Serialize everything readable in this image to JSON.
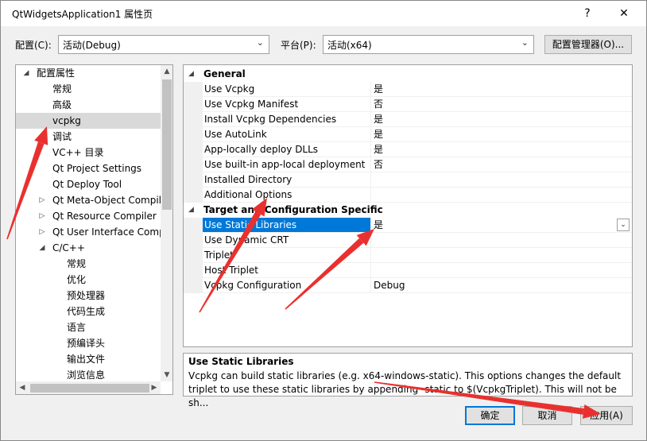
{
  "window": {
    "title": "QtWidgetsApplication1 属性页",
    "help_glyph": "?",
    "close_glyph": "✕"
  },
  "config": {
    "label": "配置(C):",
    "value": "活动(Debug)",
    "platform_label": "平台(P):",
    "platform_value": "活动(x64)",
    "manager_button": "配置管理器(O)..."
  },
  "tree": {
    "items": [
      {
        "label": "配置属性",
        "expander": "◢",
        "level": 0
      },
      {
        "label": "常规",
        "expander": "",
        "level": 1
      },
      {
        "label": "高级",
        "expander": "",
        "level": 1
      },
      {
        "label": "vcpkg",
        "expander": "",
        "level": 1,
        "selected": true
      },
      {
        "label": "调试",
        "expander": "",
        "level": 1
      },
      {
        "label": "VC++ 目录",
        "expander": "",
        "level": 1
      },
      {
        "label": "Qt Project Settings",
        "expander": "",
        "level": 1
      },
      {
        "label": "Qt Deploy Tool",
        "expander": "",
        "level": 1
      },
      {
        "label": "Qt Meta-Object Compil",
        "expander": "▷",
        "level": 1
      },
      {
        "label": "Qt Resource Compiler",
        "expander": "▷",
        "level": 1
      },
      {
        "label": "Qt User Interface Comp",
        "expander": "▷",
        "level": 1
      },
      {
        "label": "C/C++",
        "expander": "◢",
        "level": 1
      },
      {
        "label": "常规",
        "expander": "",
        "level": 2
      },
      {
        "label": "优化",
        "expander": "",
        "level": 2
      },
      {
        "label": "预处理器",
        "expander": "",
        "level": 2
      },
      {
        "label": "代码生成",
        "expander": "",
        "level": 2
      },
      {
        "label": "语言",
        "expander": "",
        "level": 2
      },
      {
        "label": "预编译头",
        "expander": "",
        "level": 2
      },
      {
        "label": "输出文件",
        "expander": "",
        "level": 2
      },
      {
        "label": "浏览信息",
        "expander": "",
        "level": 2
      }
    ]
  },
  "grid": {
    "groups": [
      {
        "label": "General",
        "rows": [
          {
            "name": "Use Vcpkg",
            "value": "是"
          },
          {
            "name": "Use Vcpkg Manifest",
            "value": "否"
          },
          {
            "name": "Install Vcpkg Dependencies",
            "value": "是"
          },
          {
            "name": "Use AutoLink",
            "value": "是"
          },
          {
            "name": "App-locally deploy DLLs",
            "value": "是"
          },
          {
            "name": "Use built-in app-local deployment",
            "value": "否"
          },
          {
            "name": "Installed Directory",
            "value": ""
          },
          {
            "name": "Additional Options",
            "value": ""
          }
        ]
      },
      {
        "label": "Target and Configuration Specific",
        "rows": [
          {
            "name": "Use Static Libraries",
            "value": "是",
            "selected": true
          },
          {
            "name": "Use Dynamic CRT",
            "value": ""
          },
          {
            "name": "Triplet",
            "value": ""
          },
          {
            "name": "Host Triplet",
            "value": ""
          },
          {
            "name": "Vcpkg Configuration",
            "value": "Debug"
          }
        ]
      }
    ]
  },
  "description": {
    "title": "Use Static Libraries",
    "text": "Vcpkg can build static libraries (e.g. x64-windows-static). This options changes the default triplet to use these static libraries by appending -static to $(VcpkgTriplet). This will not be sh..."
  },
  "buttons": {
    "ok": "确定",
    "cancel": "取消",
    "apply": "应用(A)"
  },
  "colors": {
    "selection": "#0078d7",
    "annotation_arrow": "#e8312f"
  }
}
